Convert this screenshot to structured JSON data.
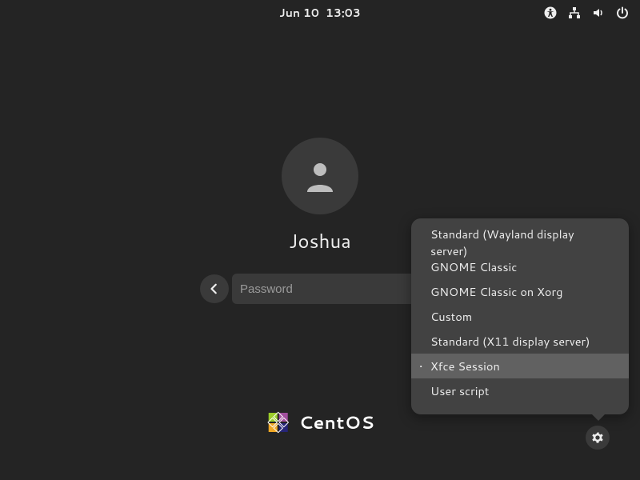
{
  "topbar": {
    "date": "Jun 10",
    "time": "13:03"
  },
  "login": {
    "username": "Joshua",
    "password_placeholder": "Password"
  },
  "brand": {
    "name": "CentOS"
  },
  "session_menu": {
    "items": [
      {
        "label": "Standard (Wayland display server)",
        "selected": false
      },
      {
        "label": "GNOME Classic",
        "selected": false
      },
      {
        "label": "GNOME Classic on Xorg",
        "selected": false
      },
      {
        "label": "Custom",
        "selected": false
      },
      {
        "label": "Standard (X11 display server)",
        "selected": false
      },
      {
        "label": "Xfce Session",
        "selected": true
      },
      {
        "label": "User script",
        "selected": false
      }
    ]
  }
}
